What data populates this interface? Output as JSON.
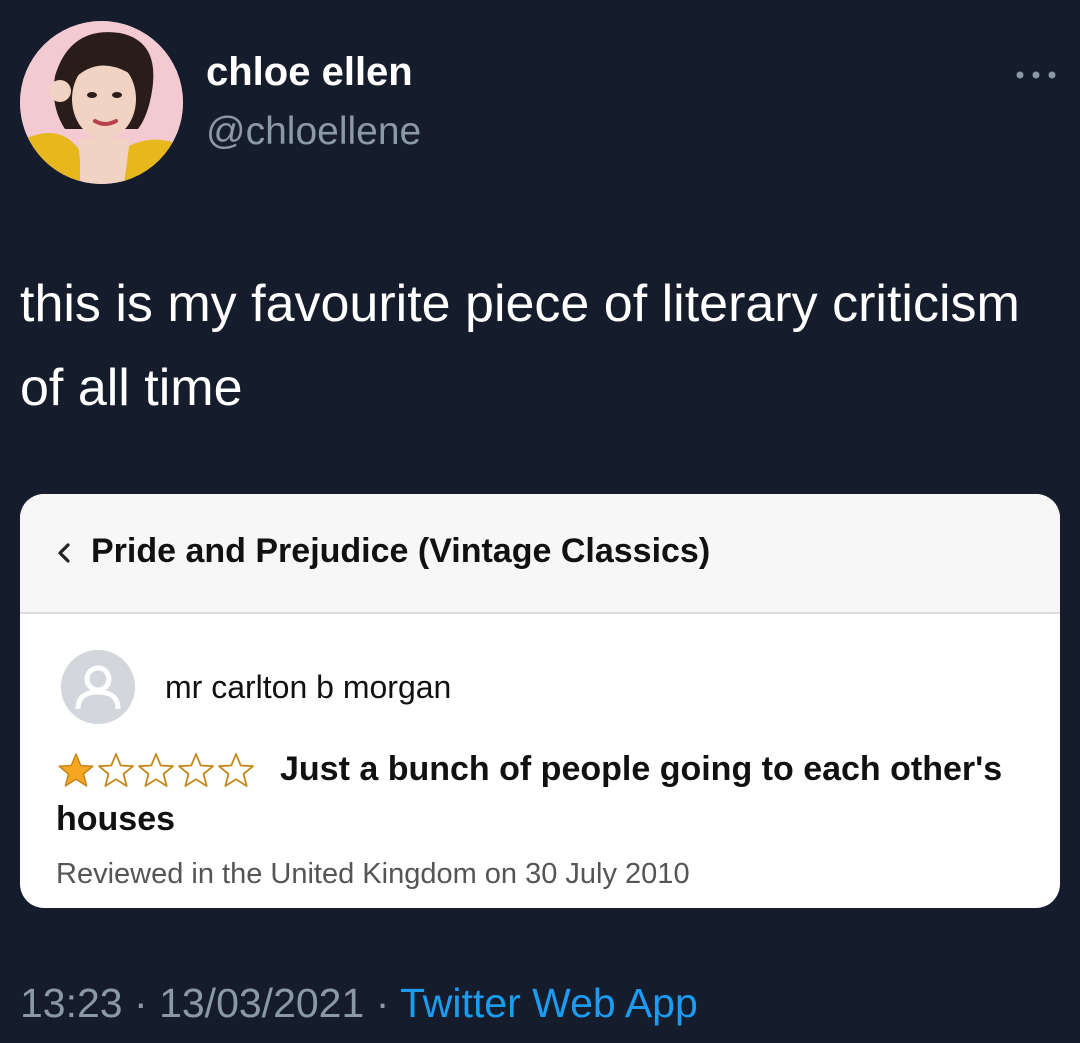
{
  "tweet": {
    "author": {
      "display_name": "chloe ellen",
      "handle": "@chloellene"
    },
    "text": "this is my favourite piece of literary criticism of all time",
    "more_icon": "more-dots-icon",
    "timestamp_time": "13:23",
    "timestamp_date": "13/03/2021",
    "separator": "·",
    "source": "Twitter Web App"
  },
  "review_card": {
    "back_icon": "chevron-left-icon",
    "book_title": "Pride and Prejudice (Vintage Classics)",
    "reviewer_name": "mr carlton b morgan",
    "rating": 1,
    "max_rating": 5,
    "review_title": "Just a bunch of people going to each other's houses",
    "review_date": "Reviewed in the United Kingdom on 30 July 2010"
  },
  "colors": {
    "background": "#151c2b",
    "secondary_text": "#8b98a5",
    "link": "#1d9bf0",
    "star_filled": "#f5a623"
  }
}
